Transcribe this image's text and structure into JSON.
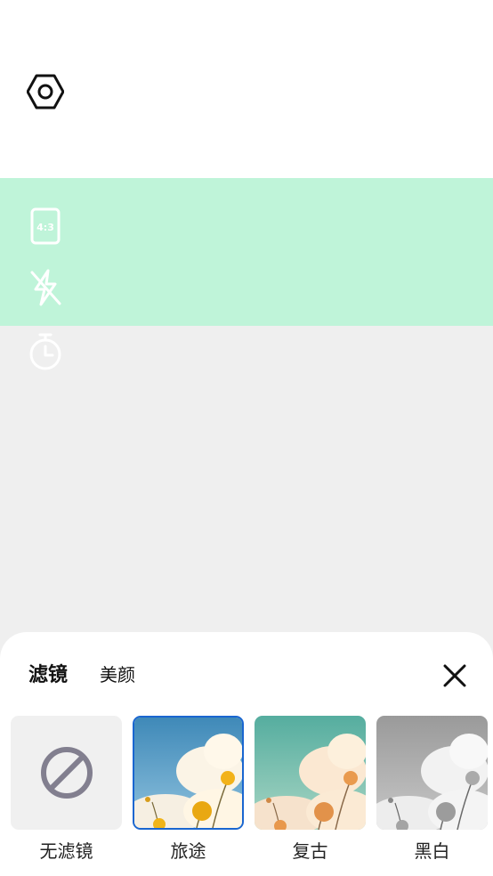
{
  "colors": {
    "accent_band": "#bff4d9",
    "viewfinder_bg": "#efefef",
    "selected_border": "#1a66d0"
  },
  "toolbar": {
    "settings_icon": "settings-icon",
    "aspect_ratio_text": "4:3",
    "flash_icon": "flash-off-icon",
    "timer_icon": "timer-icon"
  },
  "sheet": {
    "tabs": [
      {
        "label": "滤镜",
        "active": true
      },
      {
        "label": "美颜",
        "active": false
      }
    ],
    "close_icon": "close-icon",
    "filters": [
      {
        "label": "无滤镜",
        "selected": false
      },
      {
        "label": "旅途",
        "selected": true
      },
      {
        "label": "复古",
        "selected": false
      },
      {
        "label": "黑白",
        "selected": false
      }
    ]
  }
}
